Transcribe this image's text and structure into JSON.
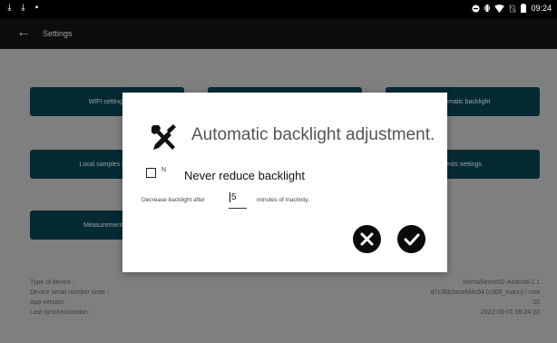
{
  "status_bar": {
    "left_icons": [
      "download-icon",
      "download-icon",
      "image-icon"
    ],
    "right_icons": [
      "minus-circle-icon",
      "vibrate-icon",
      "wifi-icon",
      "no-sim-icon",
      "battery-icon"
    ],
    "time": "09:24"
  },
  "app_bar": {
    "back_icon": "arrow-left-icon",
    "title": "Settings"
  },
  "tiles": [
    {
      "label": "WIFI settings"
    },
    {
      "label": ""
    },
    {
      "label": "Automatic backlight"
    },
    {
      "label": "Local samples sync"
    },
    {
      "label": ""
    },
    {
      "label": "Units settings"
    },
    {
      "label": "Measurements s"
    }
  ],
  "device_info": [
    {
      "label": "Type of device :",
      "value": "NomaSense02-Android-2.1"
    },
    {
      "label": "Device serial number /user :",
      "value": "d7c35b3acefd4c54 (c300_manu) / root"
    },
    {
      "label": "App version :",
      "value": "20"
    },
    {
      "label": "Last synchronization :",
      "value": "2022-06-01 09:24:22"
    }
  ],
  "dialog": {
    "icon": "tools-icon",
    "title": "Automatic backlight adjustment.",
    "checkbox_small_label": "N",
    "checkbox_label": "Never reduce backlight",
    "checkbox_checked": false,
    "decrease_label": "Decrease backlight after",
    "minutes_value": "5",
    "minutes_label": "minutes of inactivity.",
    "cancel_icon": "close-circle-icon",
    "confirm_icon": "check-circle-icon"
  }
}
